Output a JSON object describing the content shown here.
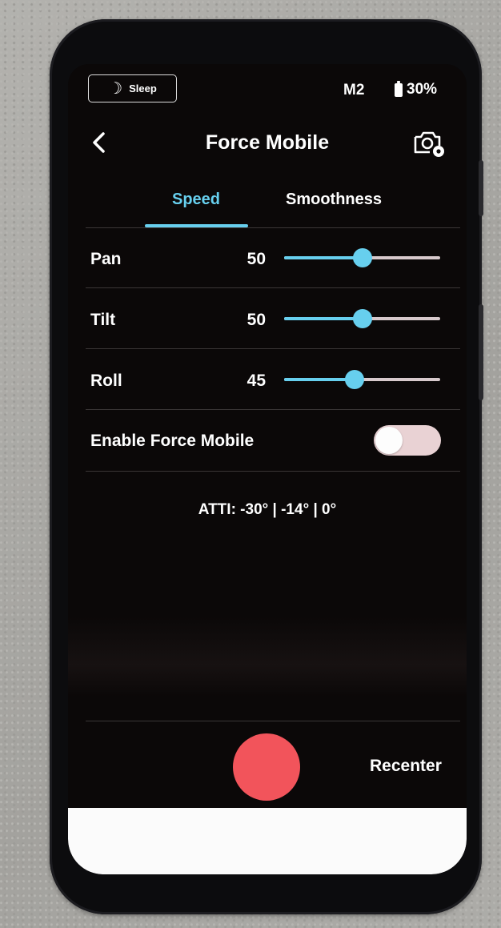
{
  "status_bar": {
    "sleep_label": "Sleep",
    "mode": "M2",
    "battery": "30%"
  },
  "header": {
    "title": "Force Mobile"
  },
  "tabs": [
    {
      "label": "Speed",
      "active": true
    },
    {
      "label": "Smoothness",
      "active": false
    }
  ],
  "settings": [
    {
      "label": "Pan",
      "value": "50",
      "level": 0.5
    },
    {
      "label": "Tilt",
      "value": "50",
      "level": 0.5
    },
    {
      "label": "Roll",
      "value": "45",
      "level": 0.45
    }
  ],
  "toggle": {
    "label": "Enable Force Mobile",
    "on": false
  },
  "atti": "ATTI: -30° | -14° | 0°",
  "bottom": {
    "recenter_label": "Recenter"
  },
  "colors": {
    "accent": "#67cfee",
    "record": "#f2545b",
    "background": "#0b0808"
  },
  "icons": [
    "moon-icon",
    "battery-icon",
    "back-icon",
    "camera-settings-icon"
  ]
}
